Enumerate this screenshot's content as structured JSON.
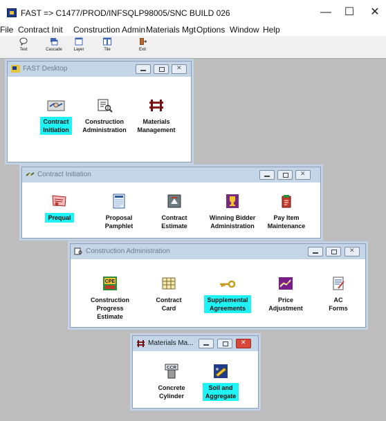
{
  "app": {
    "title": "FAST  => C1477/PROD/INFSQLP98005/SNC  BUILD 026",
    "controls": {
      "minimize": "—",
      "maximize": "☐",
      "close": "✕"
    }
  },
  "menu": [
    "File",
    "Contract Init",
    "Construction Admin",
    "Materials Mgt",
    "Options",
    "Window",
    "Help"
  ],
  "toolbar": [
    {
      "label": "Text",
      "icon": "text-balloon-icon"
    },
    {
      "label": "Cascade",
      "icon": "cascade-icon"
    },
    {
      "label": "Layer",
      "icon": "layer-icon"
    },
    {
      "label": "Tile",
      "icon": "tile-icon"
    },
    {
      "label": "Exit",
      "icon": "exit-door-icon"
    }
  ],
  "desktop": {
    "title": "FAST Desktop",
    "items": [
      {
        "label": "Contract\nInitiation",
        "selected": true,
        "icon": "handshake-icon"
      },
      {
        "label": "Construction\nAdministration",
        "selected": false,
        "icon": "book-magnifier-icon"
      },
      {
        "label": "Materials\nManagement",
        "selected": false,
        "icon": "barrier-icon"
      }
    ]
  },
  "contract_initiation": {
    "title": "Contract Initiation",
    "items": [
      {
        "label": "Prequal",
        "selected": true,
        "icon": "certificate-icon"
      },
      {
        "label": "Proposal\nPamphlet",
        "selected": false,
        "icon": "pamphlet-icon"
      },
      {
        "label": "Contract\nEstimate",
        "selected": false,
        "icon": "estimate-icon"
      },
      {
        "label": "Winning Bidder\nAdministration",
        "selected": false,
        "icon": "trophy-icon"
      },
      {
        "label": "Pay Item\nMaintenance",
        "selected": false,
        "icon": "pay-item-icon"
      }
    ]
  },
  "construction_admin": {
    "title": "Construction Administration",
    "items": [
      {
        "label": "Construction\nProgress\nEstimate",
        "selected": false,
        "icon": "cpe-icon"
      },
      {
        "label": "Contract\nCard",
        "selected": false,
        "icon": "contract-card-icon"
      },
      {
        "label": "Supplemental\nAgreements",
        "selected": true,
        "icon": "key-icon"
      },
      {
        "label": "Price\nAdjustment",
        "selected": false,
        "icon": "price-chart-icon"
      },
      {
        "label": "AC\nForms",
        "selected": false,
        "icon": "ac-forms-icon"
      }
    ]
  },
  "materials": {
    "title": "Materials Ma...",
    "items": [
      {
        "label": "Concrete\nCylinder",
        "selected": false,
        "icon": "ccr-cylinder-icon"
      },
      {
        "label": "Soil and\nAggregate",
        "selected": true,
        "icon": "soil-aggregate-icon"
      }
    ]
  },
  "colors": {
    "selection": "#1ff3f5",
    "child_title": "#c4d5e8",
    "workspace": "#bdbdbd"
  }
}
